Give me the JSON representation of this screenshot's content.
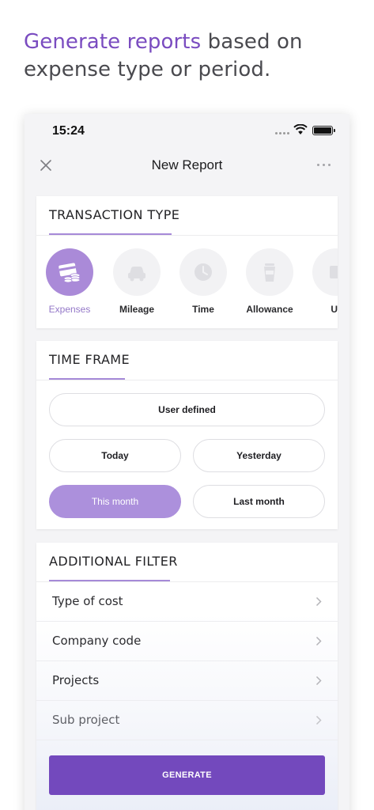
{
  "headline": {
    "accent": "Generate reports",
    "rest": " based on expense type or period."
  },
  "status_bar": {
    "time": "15:24"
  },
  "nav": {
    "title": "New Report",
    "close_icon": "close-icon",
    "more_icon": "more-icon"
  },
  "transaction_type": {
    "title": "TRANSACTION TYPE",
    "items": [
      {
        "label": "Expenses",
        "icon": "expenses-card-icon",
        "selected": true
      },
      {
        "label": "Mileage",
        "icon": "car-icon",
        "selected": false
      },
      {
        "label": "Time",
        "icon": "clock-icon",
        "selected": false
      },
      {
        "label": "Allowance",
        "icon": "coffee-cup-icon",
        "selected": false
      },
      {
        "label": "Ur",
        "icon": "partial-icon",
        "selected": false
      }
    ]
  },
  "time_frame": {
    "title": "TIME FRAME",
    "options": {
      "user_defined": "User defined",
      "today": "Today",
      "yesterday": "Yesterday",
      "this_month": "This month",
      "last_month": "Last month"
    },
    "selected": "This month"
  },
  "additional_filter": {
    "title": "ADDITIONAL FILTER",
    "items": [
      {
        "label": "Type of cost"
      },
      {
        "label": "Company code"
      },
      {
        "label": "Projects"
      },
      {
        "label": "Sub project"
      }
    ]
  },
  "generate_label": "GENERATE",
  "colors": {
    "accent": "#7a4cc0",
    "selected_fill": "#ac90dc",
    "button": "#7349bd"
  }
}
